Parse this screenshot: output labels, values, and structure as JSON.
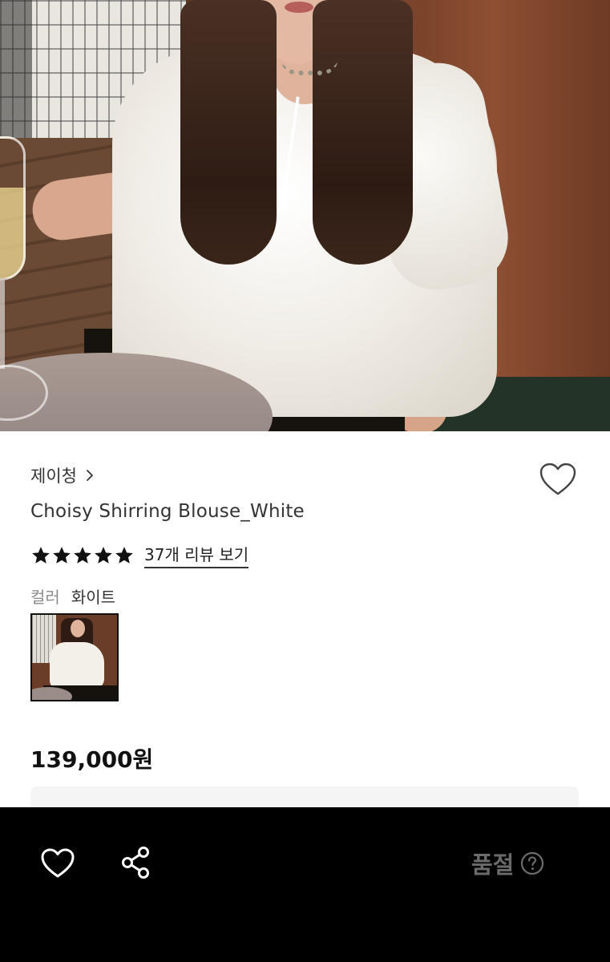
{
  "hero": {
    "image_icon": "product-model-photo"
  },
  "product": {
    "brand": "제이청",
    "brand_chevron_icon": "chevron-right-icon",
    "title": "Choisy Shirring Blouse_White",
    "rating": {
      "stars": 5,
      "max": 5
    },
    "review_link": "37개 리뷰 보기",
    "color_label": "컬러",
    "color_value": "화이트",
    "price": "139,000원"
  },
  "icons": {
    "wishlist": "heart-outline-icon",
    "share": "share-icon",
    "help": "question-circle-icon"
  },
  "bottom_bar": {
    "status": "품절"
  },
  "colors": {
    "accent": "#000000",
    "sold_out_text": "#6b6b6b",
    "secondary_text": "#8a8a8a"
  }
}
